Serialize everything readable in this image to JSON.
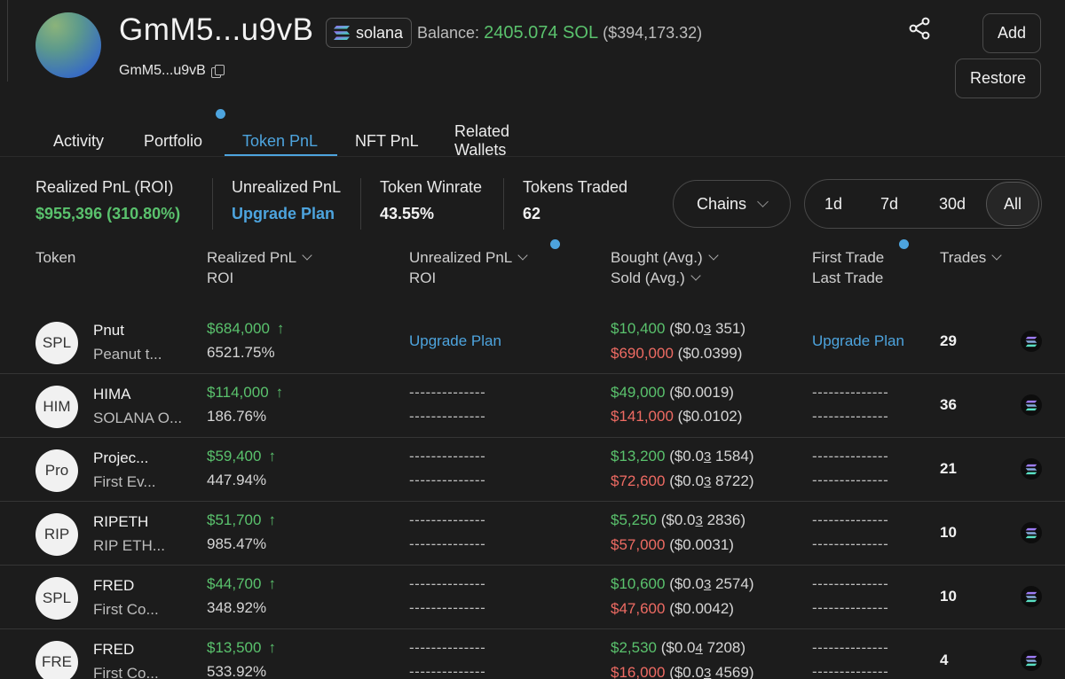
{
  "header": {
    "wallet_title": "GmM5...u9vB",
    "wallet_sub": "GmM5...u9vB",
    "chain": "solana",
    "balance_label": "Balance:",
    "balance_value": "2405.074 SOL",
    "balance_usd": "($394,173.32)",
    "add_label": "Add",
    "restore_label": "Restore"
  },
  "tabs": [
    "Activity",
    "Portfolio",
    "Token PnL",
    "NFT PnL",
    "Related Wallets"
  ],
  "active_tab": "Token PnL",
  "stats": {
    "realized_label": "Realized PnL (ROI)",
    "realized_value": "$955,396 (310.80%)",
    "unrealized_label": "Unrealized PnL",
    "unrealized_value": "Upgrade Plan",
    "winrate_label": "Token Winrate",
    "winrate_value": "43.55%",
    "traded_label": "Tokens Traded",
    "traded_value": "62"
  },
  "filters": {
    "chains_label": "Chains",
    "ranges": [
      "1d",
      "7d",
      "30d",
      "All"
    ],
    "active_range": "All"
  },
  "table_headers": {
    "token": "Token",
    "realized_1": "Realized PnL",
    "realized_2": "ROI",
    "unrealized_1": "Unrealized PnL",
    "unrealized_2": "ROI",
    "bought": "Bought (Avg.)",
    "sold": "Sold (Avg.)",
    "first_trade": "First Trade",
    "last_trade": "Last Trade",
    "trades": "Trades"
  },
  "rows": [
    {
      "icon": "SPL",
      "name": "Pnut",
      "sub": "Peanut t...",
      "pnl": "$684,000",
      "roi": "6521.75%",
      "unrealized_1": "Upgrade Plan",
      "unrealized_2": "",
      "bought": "$10,400",
      "bought_pre": "($0.0",
      "bought_z": "3",
      "bought_post": "351)",
      "sold": "$690,000",
      "sold_pre": "($0.0399)",
      "sold_z": "",
      "sold_post": "",
      "first": "Upgrade Plan",
      "last": "",
      "trades": "29"
    },
    {
      "icon": "HIM",
      "name": "HIMA",
      "sub": "SOLANA O...",
      "pnl": "$114,000",
      "roi": "186.76%",
      "unrealized_1": "--------------",
      "unrealized_2": "--------------",
      "bought": "$49,000",
      "bought_pre": "($0.0019)",
      "bought_z": "",
      "bought_post": "",
      "sold": "$141,000",
      "sold_pre": "($0.0102)",
      "sold_z": "",
      "sold_post": "",
      "first": "--------------",
      "last": "--------------",
      "trades": "36"
    },
    {
      "icon": "Pro",
      "name": "Projec...",
      "sub": "First Ev...",
      "pnl": "$59,400",
      "roi": "447.94%",
      "unrealized_1": "--------------",
      "unrealized_2": "--------------",
      "bought": "$13,200",
      "bought_pre": "($0.0",
      "bought_z": "3",
      "bought_post": "1584)",
      "sold": "$72,600",
      "sold_pre": "($0.0",
      "sold_z": "3",
      "sold_post": "8722)",
      "first": "--------------",
      "last": "--------------",
      "trades": "21"
    },
    {
      "icon": "RIP",
      "name": "RIPETH",
      "sub": "RIP ETH...",
      "pnl": "$51,700",
      "roi": "985.47%",
      "unrealized_1": "--------------",
      "unrealized_2": "--------------",
      "bought": "$5,250",
      "bought_pre": "($0.0",
      "bought_z": "3",
      "bought_post": "2836)",
      "sold": "$57,000",
      "sold_pre": "($0.0031)",
      "sold_z": "",
      "sold_post": "",
      "first": "--------------",
      "last": "--------------",
      "trades": "10"
    },
    {
      "icon": "SPL",
      "name": "FRED",
      "sub": "First Co...",
      "pnl": "$44,700",
      "roi": "348.92%",
      "unrealized_1": "--------------",
      "unrealized_2": "--------------",
      "bought": "$10,600",
      "bought_pre": "($0.0",
      "bought_z": "3",
      "bought_post": "2574)",
      "sold": "$47,600",
      "sold_pre": "($0.0042)",
      "sold_z": "",
      "sold_post": "",
      "first": "--------------",
      "last": "--------------",
      "trades": "10"
    },
    {
      "icon": "FRE",
      "name": "FRED",
      "sub": "First Co...",
      "pnl": "$13,500",
      "roi": "533.92%",
      "unrealized_1": "--------------",
      "unrealized_2": "--------------",
      "bought": "$2,530",
      "bought_pre": "($0.0",
      "bought_z": "4",
      "bought_post": "7208)",
      "sold": "$16,000",
      "sold_pre": "($0.0",
      "sold_z": "3",
      "sold_post": "4569)",
      "first": "--------------",
      "last": "--------------",
      "trades": "4"
    }
  ],
  "icons": {
    "share": "share-icon",
    "copy": "copy-icon",
    "chain": "solana-icon",
    "sort": "chevron-down-icon",
    "trend": "arrow-up-icon",
    "arrow_glyph": "↑"
  },
  "colors": {
    "positive": "#5ac26d",
    "negative": "#ee6b63",
    "accent": "#4da4de",
    "background": "#1c1c1c"
  }
}
